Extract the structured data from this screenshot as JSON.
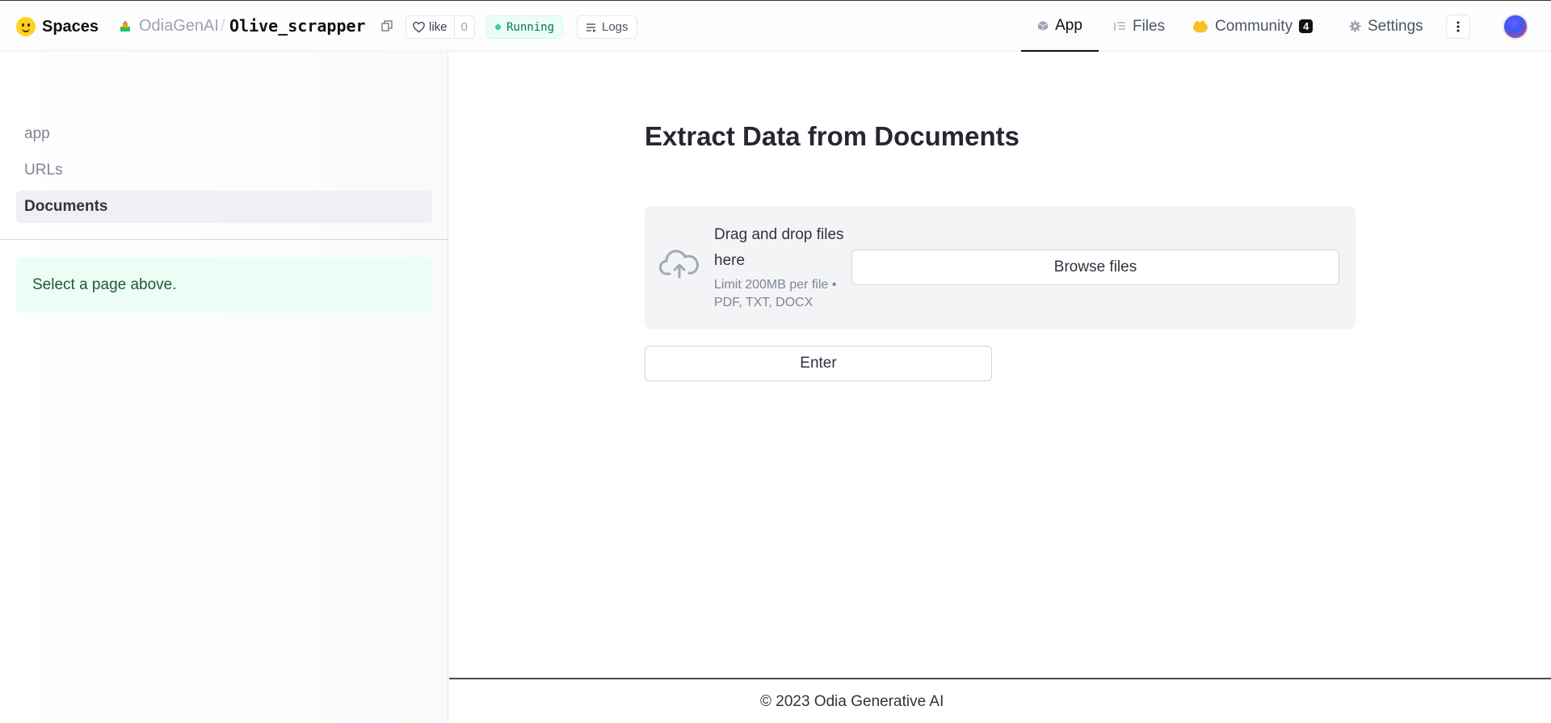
{
  "header": {
    "brand": "Spaces",
    "org": "OdiaGenAI",
    "separator": "/",
    "repo": "Olive_scrapper",
    "like_label": "like",
    "like_count": "0",
    "status": "Running",
    "logs_label": "Logs",
    "tabs": [
      {
        "label": "App",
        "active": true
      },
      {
        "label": "Files"
      },
      {
        "label": "Community",
        "badge": "4"
      },
      {
        "label": "Settings"
      }
    ]
  },
  "sidebar": {
    "items": [
      {
        "label": "app"
      },
      {
        "label": "URLs"
      },
      {
        "label": "Documents",
        "active": true
      }
    ],
    "info": "Select a page above."
  },
  "main": {
    "title": "Extract Data from Documents",
    "uploader": {
      "title": "Drag and drop files here",
      "limit": "Limit 200MB per file • PDF, TXT, DOCX",
      "browse_label": "Browse files"
    },
    "enter_label": "Enter"
  },
  "footer": {
    "text": "© 2023 Odia Generative AI"
  },
  "colors": {
    "status_bg": "#ecfdf5",
    "status_text": "#047857",
    "info_bg": "#ecfdf5",
    "dropzone_bg": "#f3f4f6"
  }
}
